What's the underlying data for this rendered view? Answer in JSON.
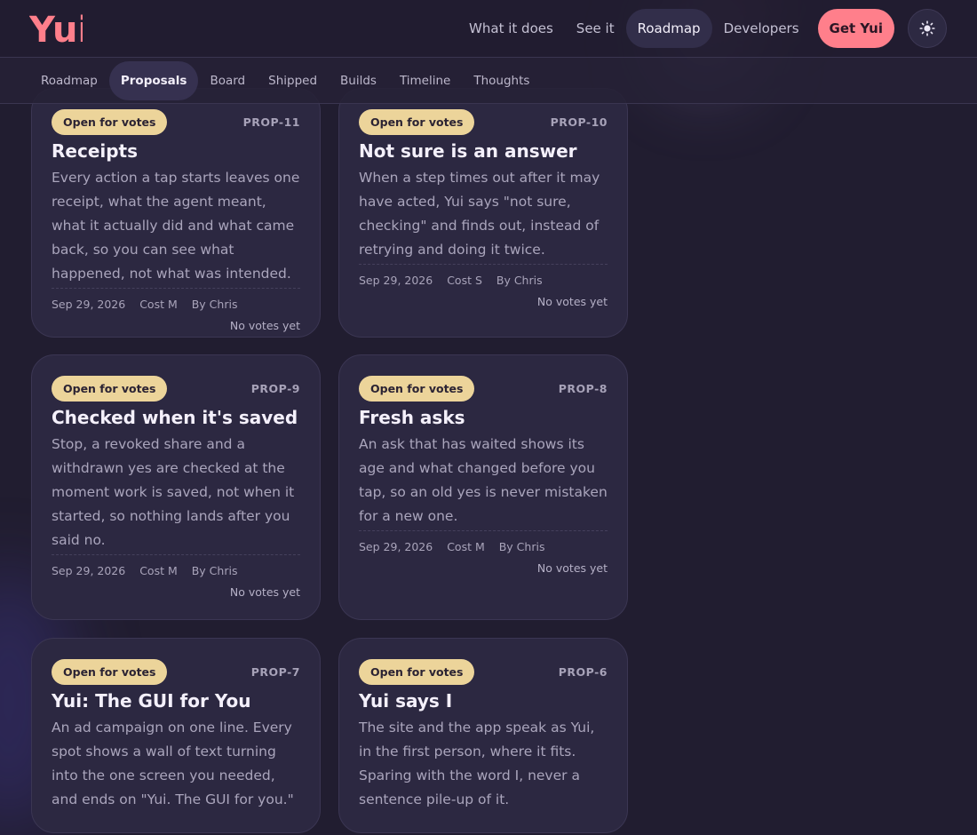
{
  "brand": {
    "logo_text": "Yui",
    "accent": "#ff7f8b"
  },
  "nav": {
    "items": [
      {
        "label": "What it does",
        "active": false
      },
      {
        "label": "See it",
        "active": false
      },
      {
        "label": "Roadmap",
        "active": true
      },
      {
        "label": "Developers",
        "active": false
      }
    ],
    "cta_label": "Get Yui",
    "theme_icon": "sun-icon"
  },
  "subnav": {
    "tabs": [
      {
        "label": "Roadmap",
        "active": false
      },
      {
        "label": "Proposals",
        "active": true
      },
      {
        "label": "Board",
        "active": false
      },
      {
        "label": "Shipped",
        "active": false
      },
      {
        "label": "Builds",
        "active": false
      },
      {
        "label": "Timeline",
        "active": false
      },
      {
        "label": "Thoughts",
        "active": false
      }
    ]
  },
  "proposals": [
    {
      "status": "Open for votes",
      "id": "PROP-11",
      "title": "Receipts",
      "description": "Every action a tap starts leaves one receipt, what the agent meant, what it actually did and what came back, so you can see what happened, not what was intended.",
      "date": "Sep 29, 2026",
      "cost": "Cost M",
      "author": "By Chris",
      "votes": "No votes yet"
    },
    {
      "status": "Open for votes",
      "id": "PROP-10",
      "title": "Not sure is an answer",
      "description": "When a step times out after it may have acted, Yui says \"not sure, checking\" and finds out, instead of retrying and doing it twice.",
      "date": "Sep 29, 2026",
      "cost": "Cost S",
      "author": "By Chris",
      "votes": "No votes yet"
    },
    {
      "status": "Open for votes",
      "id": "PROP-9",
      "title": "Checked when it's saved",
      "description": "Stop, a revoked share and a withdrawn yes are checked at the moment work is saved, not when it started, so nothing lands after you said no.",
      "date": "Sep 29, 2026",
      "cost": "Cost M",
      "author": "By Chris",
      "votes": "No votes yet"
    },
    {
      "status": "Open for votes",
      "id": "PROP-8",
      "title": "Fresh asks",
      "description": "An ask that has waited shows its age and what changed before you tap, so an old yes is never mistaken for a new one.",
      "date": "Sep 29, 2026",
      "cost": "Cost M",
      "author": "By Chris",
      "votes": "No votes yet"
    },
    {
      "status": "Open for votes",
      "id": "PROP-7",
      "title": "Yui: The GUI for You",
      "description": "An ad campaign on one line. Every spot shows a wall of text turning into the one screen you needed, and ends on \"Yui. The GUI for you.\"",
      "date": "",
      "cost": "",
      "author": "",
      "votes": ""
    },
    {
      "status": "Open for votes",
      "id": "PROP-6",
      "title": "Yui says I",
      "description": "The site and the app speak as Yui, in the first person, where it fits. Sparing with the word I, never a sentence pile-up of it.",
      "date": "",
      "cost": "",
      "author": "",
      "votes": ""
    }
  ]
}
